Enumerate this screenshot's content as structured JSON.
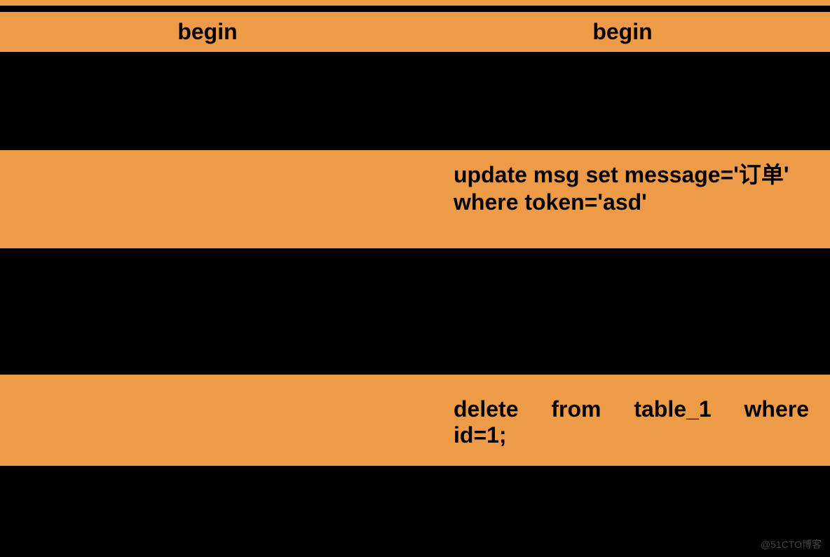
{
  "table": {
    "headers": {
      "left": "begin",
      "right": "begin"
    },
    "rows": [
      {
        "left": "",
        "right": ""
      },
      {
        "left": "",
        "right_line1": "update msg set message='订单'",
        "right_line2": "where token='asd'"
      },
      {
        "left": "",
        "right": ""
      },
      {
        "left": "",
        "right_words": [
          "delete",
          "from",
          "table_1",
          "where"
        ],
        "right_line2": "id=1;"
      }
    ]
  },
  "watermark": "@51CTO博客"
}
